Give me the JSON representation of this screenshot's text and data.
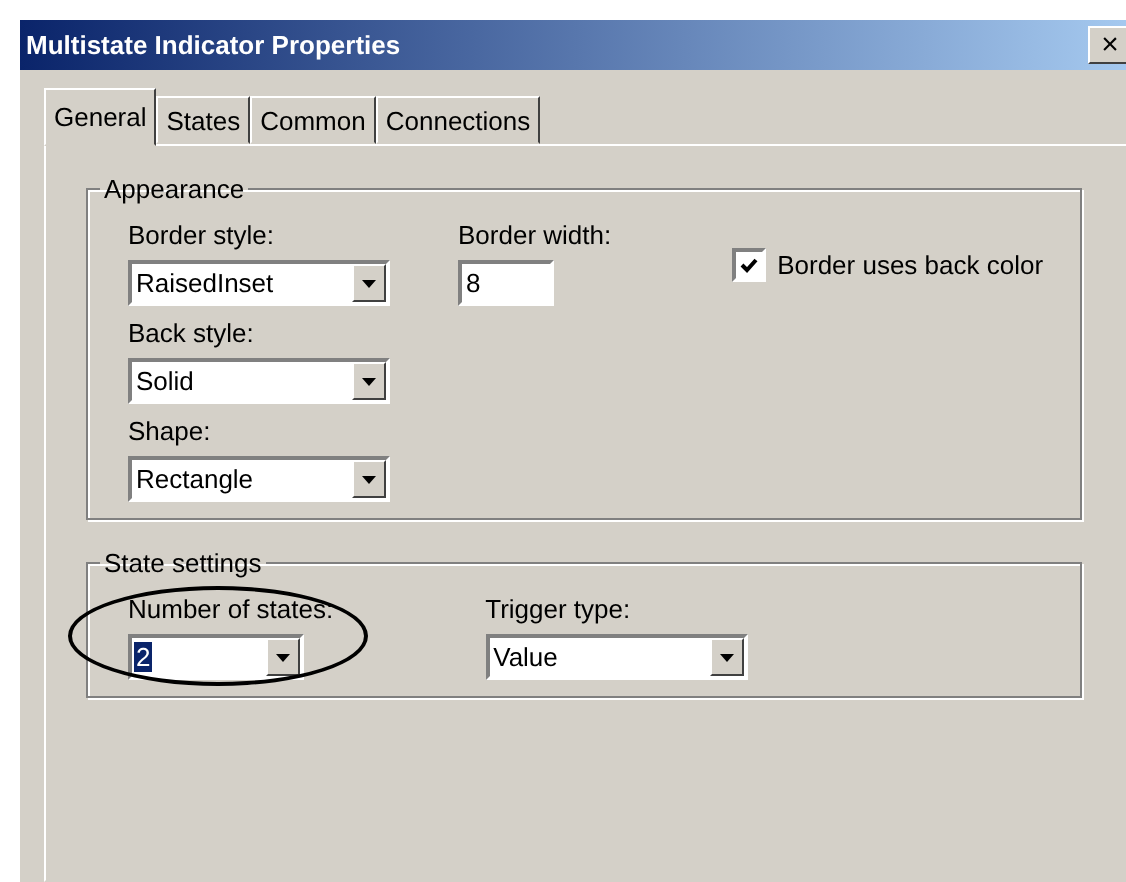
{
  "window": {
    "title": "Multistate Indicator Properties",
    "close": "×"
  },
  "tabs": [
    {
      "label": "General",
      "selected": true
    },
    {
      "label": "States",
      "selected": false
    },
    {
      "label": "Common",
      "selected": false
    },
    {
      "label": "Connections",
      "selected": false
    }
  ],
  "appearance": {
    "legend": "Appearance",
    "border_style": {
      "label": "Border style:",
      "value": "RaisedInset"
    },
    "border_width": {
      "label": "Border width:",
      "value": "8"
    },
    "border_uses_back_color": {
      "label": "Border uses back color",
      "checked": true
    },
    "back_style": {
      "label": "Back style:",
      "value": "Solid"
    },
    "shape": {
      "label": "Shape:",
      "value": "Rectangle"
    }
  },
  "state_settings": {
    "legend": "State settings",
    "number_of_states": {
      "label": "Number of states:",
      "value": "2",
      "text_selected": true,
      "circled": true
    },
    "trigger_type": {
      "label": "Trigger type:",
      "value": "Value"
    }
  }
}
